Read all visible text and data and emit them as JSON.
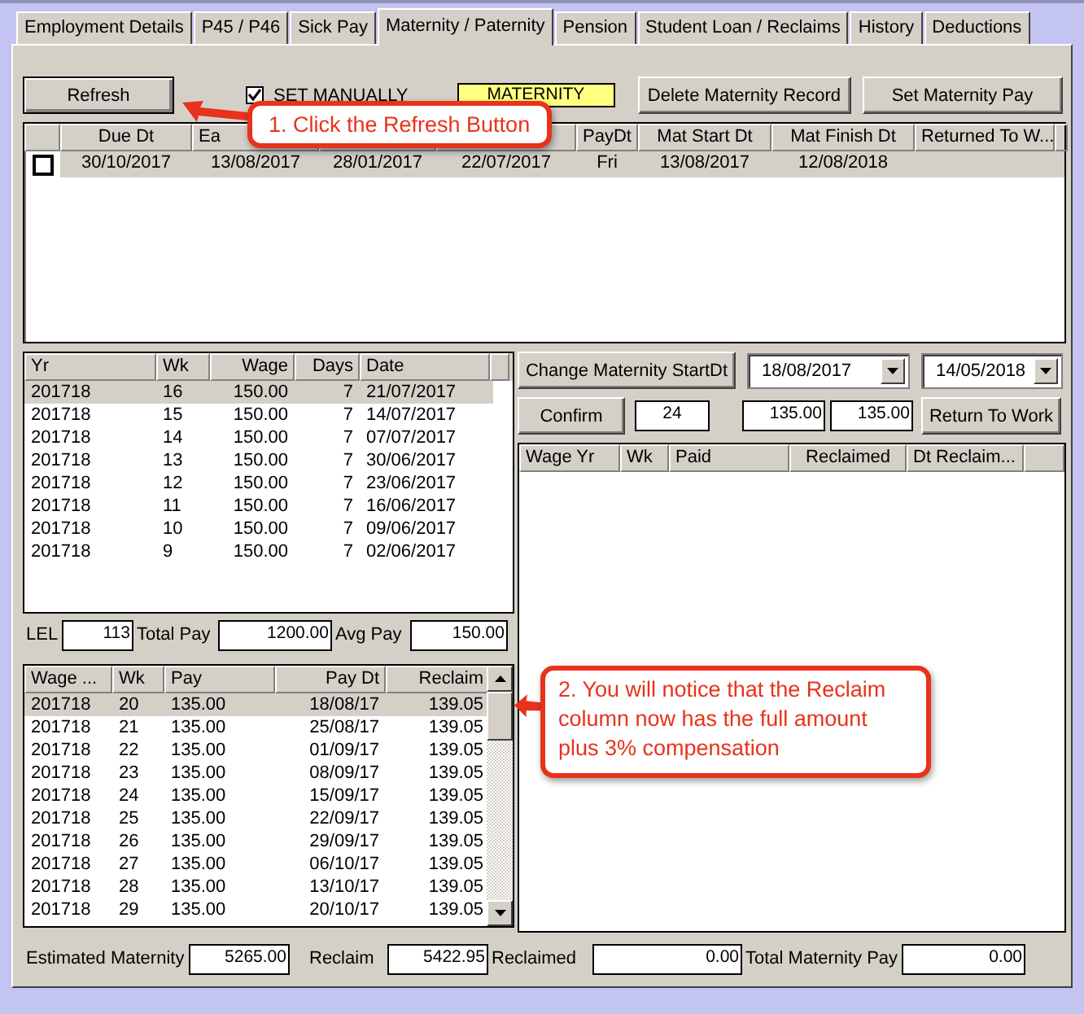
{
  "tabs": [
    {
      "label": "Employment Details",
      "selected": false
    },
    {
      "label": "P45 / P46",
      "selected": false
    },
    {
      "label": "Sick Pay",
      "selected": false
    },
    {
      "label": "Maternity / Paternity",
      "selected": true
    },
    {
      "label": "Pension",
      "selected": false
    },
    {
      "label": "Student Loan / Reclaims",
      "selected": false
    },
    {
      "label": "History",
      "selected": false
    },
    {
      "label": "Deductions",
      "selected": false
    }
  ],
  "toolbar": {
    "refresh_button": "Refresh",
    "set_manually": {
      "label": "SET MANUALLY",
      "checked": true
    },
    "leave_type": "MATERNITY",
    "delete_button": "Delete Maternity Record",
    "set_pay_button": "Set Maternity Pay"
  },
  "records_table": {
    "columns": [
      {
        "label": "Due Dt"
      },
      {
        "label": "Ea"
      },
      {},
      {},
      {
        "label": "PayDt"
      },
      {
        "label": "Mat Start Dt"
      },
      {
        "label": "Mat Finish Dt"
      },
      {
        "label": "Returned To W..."
      }
    ],
    "rows": [
      {
        "checked": false,
        "selected": true,
        "cells": [
          "30/10/2017",
          "13/08/2017",
          "28/01/2017",
          "22/07/2017",
          "Fri",
          "13/08/2017",
          "12/08/2018"
        ]
      }
    ]
  },
  "earnings_table": {
    "columns": [
      "Yr",
      "Wk",
      "Wage",
      "Days",
      "Date"
    ],
    "rows": [
      {
        "selected": true,
        "cells": [
          "201718",
          "16",
          "150.00",
          "7",
          "21/07/2017"
        ]
      },
      {
        "selected": false,
        "cells": [
          "201718",
          "15",
          "150.00",
          "7",
          "14/07/2017"
        ]
      },
      {
        "selected": false,
        "cells": [
          "201718",
          "14",
          "150.00",
          "7",
          "07/07/2017"
        ]
      },
      {
        "selected": false,
        "cells": [
          "201718",
          "13",
          "150.00",
          "7",
          "30/06/2017"
        ]
      },
      {
        "selected": false,
        "cells": [
          "201718",
          "12",
          "150.00",
          "7",
          "23/06/2017"
        ]
      },
      {
        "selected": false,
        "cells": [
          "201718",
          "11",
          "150.00",
          "7",
          "16/06/2017"
        ]
      },
      {
        "selected": false,
        "cells": [
          "201718",
          "10",
          "150.00",
          "7",
          "09/06/2017"
        ]
      },
      {
        "selected": false,
        "cells": [
          "201718",
          "9",
          "150.00",
          "7",
          "02/06/2017"
        ]
      }
    ]
  },
  "totals": [
    {
      "label": "LEL",
      "value": "113"
    },
    {
      "label": "Total Pay",
      "value": "1200.00"
    },
    {
      "label": "Avg Pay",
      "value": "150.00"
    }
  ],
  "pay_table": {
    "columns": [
      "Wage ...",
      "Wk",
      "Pay",
      "Pay Dt",
      "Reclaim"
    ],
    "rows": [
      {
        "selected": true,
        "cells": [
          "201718",
          "20",
          "135.00",
          "18/08/17",
          "139.05"
        ]
      },
      {
        "selected": false,
        "cells": [
          "201718",
          "21",
          "135.00",
          "25/08/17",
          "139.05"
        ]
      },
      {
        "selected": false,
        "cells": [
          "201718",
          "22",
          "135.00",
          "01/09/17",
          "139.05"
        ]
      },
      {
        "selected": false,
        "cells": [
          "201718",
          "23",
          "135.00",
          "08/09/17",
          "139.05"
        ]
      },
      {
        "selected": false,
        "cells": [
          "201718",
          "24",
          "135.00",
          "15/09/17",
          "139.05"
        ]
      },
      {
        "selected": false,
        "cells": [
          "201718",
          "25",
          "135.00",
          "22/09/17",
          "139.05"
        ]
      },
      {
        "selected": false,
        "cells": [
          "201718",
          "26",
          "135.00",
          "29/09/17",
          "139.05"
        ]
      },
      {
        "selected": false,
        "cells": [
          "201718",
          "27",
          "135.00",
          "06/10/17",
          "139.05"
        ]
      },
      {
        "selected": false,
        "cells": [
          "201718",
          "28",
          "135.00",
          "13/10/17",
          "139.05"
        ]
      },
      {
        "selected": false,
        "cells": [
          "201718",
          "29",
          "135.00",
          "20/10/17",
          "139.05"
        ]
      }
    ]
  },
  "controls": {
    "change_start_button": "Change Maternity StartDt",
    "start_date": "18/08/2017",
    "end_date": "14/05/2018",
    "confirm_button": "Confirm",
    "weeks": "24",
    "rate_1": "135.00",
    "rate_2": "135.00",
    "return_button": "Return To Work"
  },
  "reclaim_table": {
    "columns": [
      "Wage Yr",
      "Wk",
      "Paid",
      "Reclaimed",
      "Dt Reclaim..."
    ]
  },
  "summary": [
    {
      "label": "Estimated Maternity",
      "value": "5265.00"
    },
    {
      "label": "Reclaim",
      "value": "5422.95"
    },
    {
      "label": "Reclaimed",
      "value": "0.00"
    },
    {
      "label": "Total Maternity Pay",
      "value": "0.00"
    }
  ],
  "callouts": [
    {
      "text": "1. Click the Refresh Button"
    },
    {
      "text": "2. You will notice that the Reclaim column now has the full amount plus 3% compensation"
    }
  ]
}
